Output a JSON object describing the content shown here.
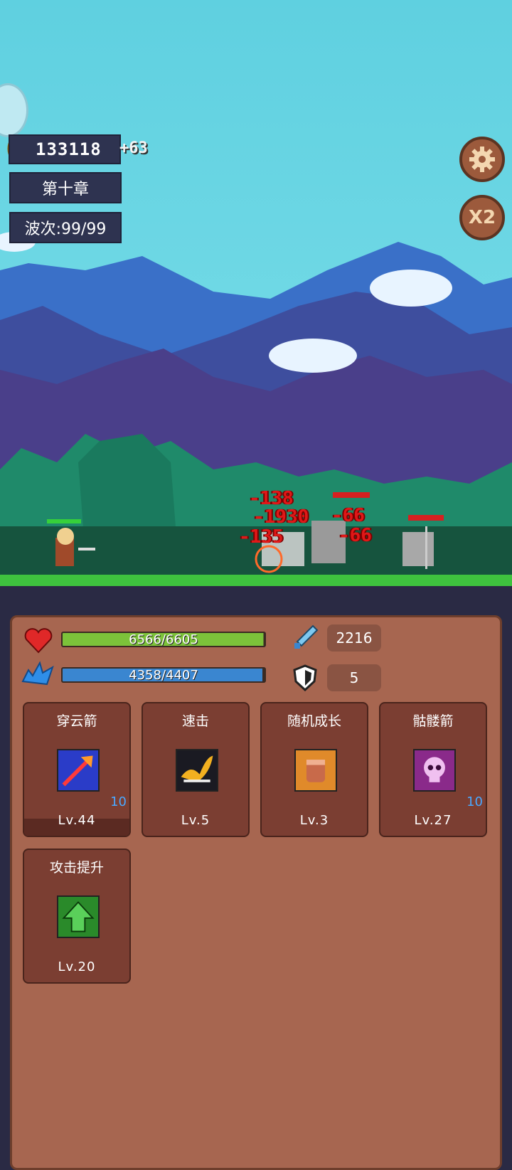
{
  "hud": {
    "coins": "133118",
    "coin_bonus": "+63",
    "chapter": "第十章",
    "wave": "波次:99/99",
    "speed_label": "X2"
  },
  "damage_numbers": [
    "-138",
    "-1930",
    "-66",
    "-135",
    "-66"
  ],
  "stats": {
    "hp": "6566/6605",
    "hp_fraction": 0.994,
    "mp": "4358/4407",
    "mp_fraction": 0.989,
    "attack": "2216",
    "defense": "5"
  },
  "skills": [
    {
      "name": "穿云箭",
      "level": "Lv.44",
      "count": "10",
      "icon": "piercing-arrow-icon"
    },
    {
      "name": "速击",
      "level": "Lv.5",
      "count": "",
      "icon": "quick-strike-icon"
    },
    {
      "name": "随机成长",
      "level": "Lv.3",
      "count": "",
      "icon": "fist-icon"
    },
    {
      "name": "骷髅箭",
      "level": "Lv.27",
      "count": "10",
      "icon": "skull-icon"
    },
    {
      "name": "攻击提升",
      "level": "Lv.20",
      "count": "",
      "icon": "arrow-up-icon"
    }
  ],
  "colors": {
    "sky": "#5fd0e0",
    "panel": "#a76650",
    "card": "#7b3e32",
    "hp": "#7cc23a",
    "mp": "#3a86d0",
    "damage": "#e01818"
  }
}
